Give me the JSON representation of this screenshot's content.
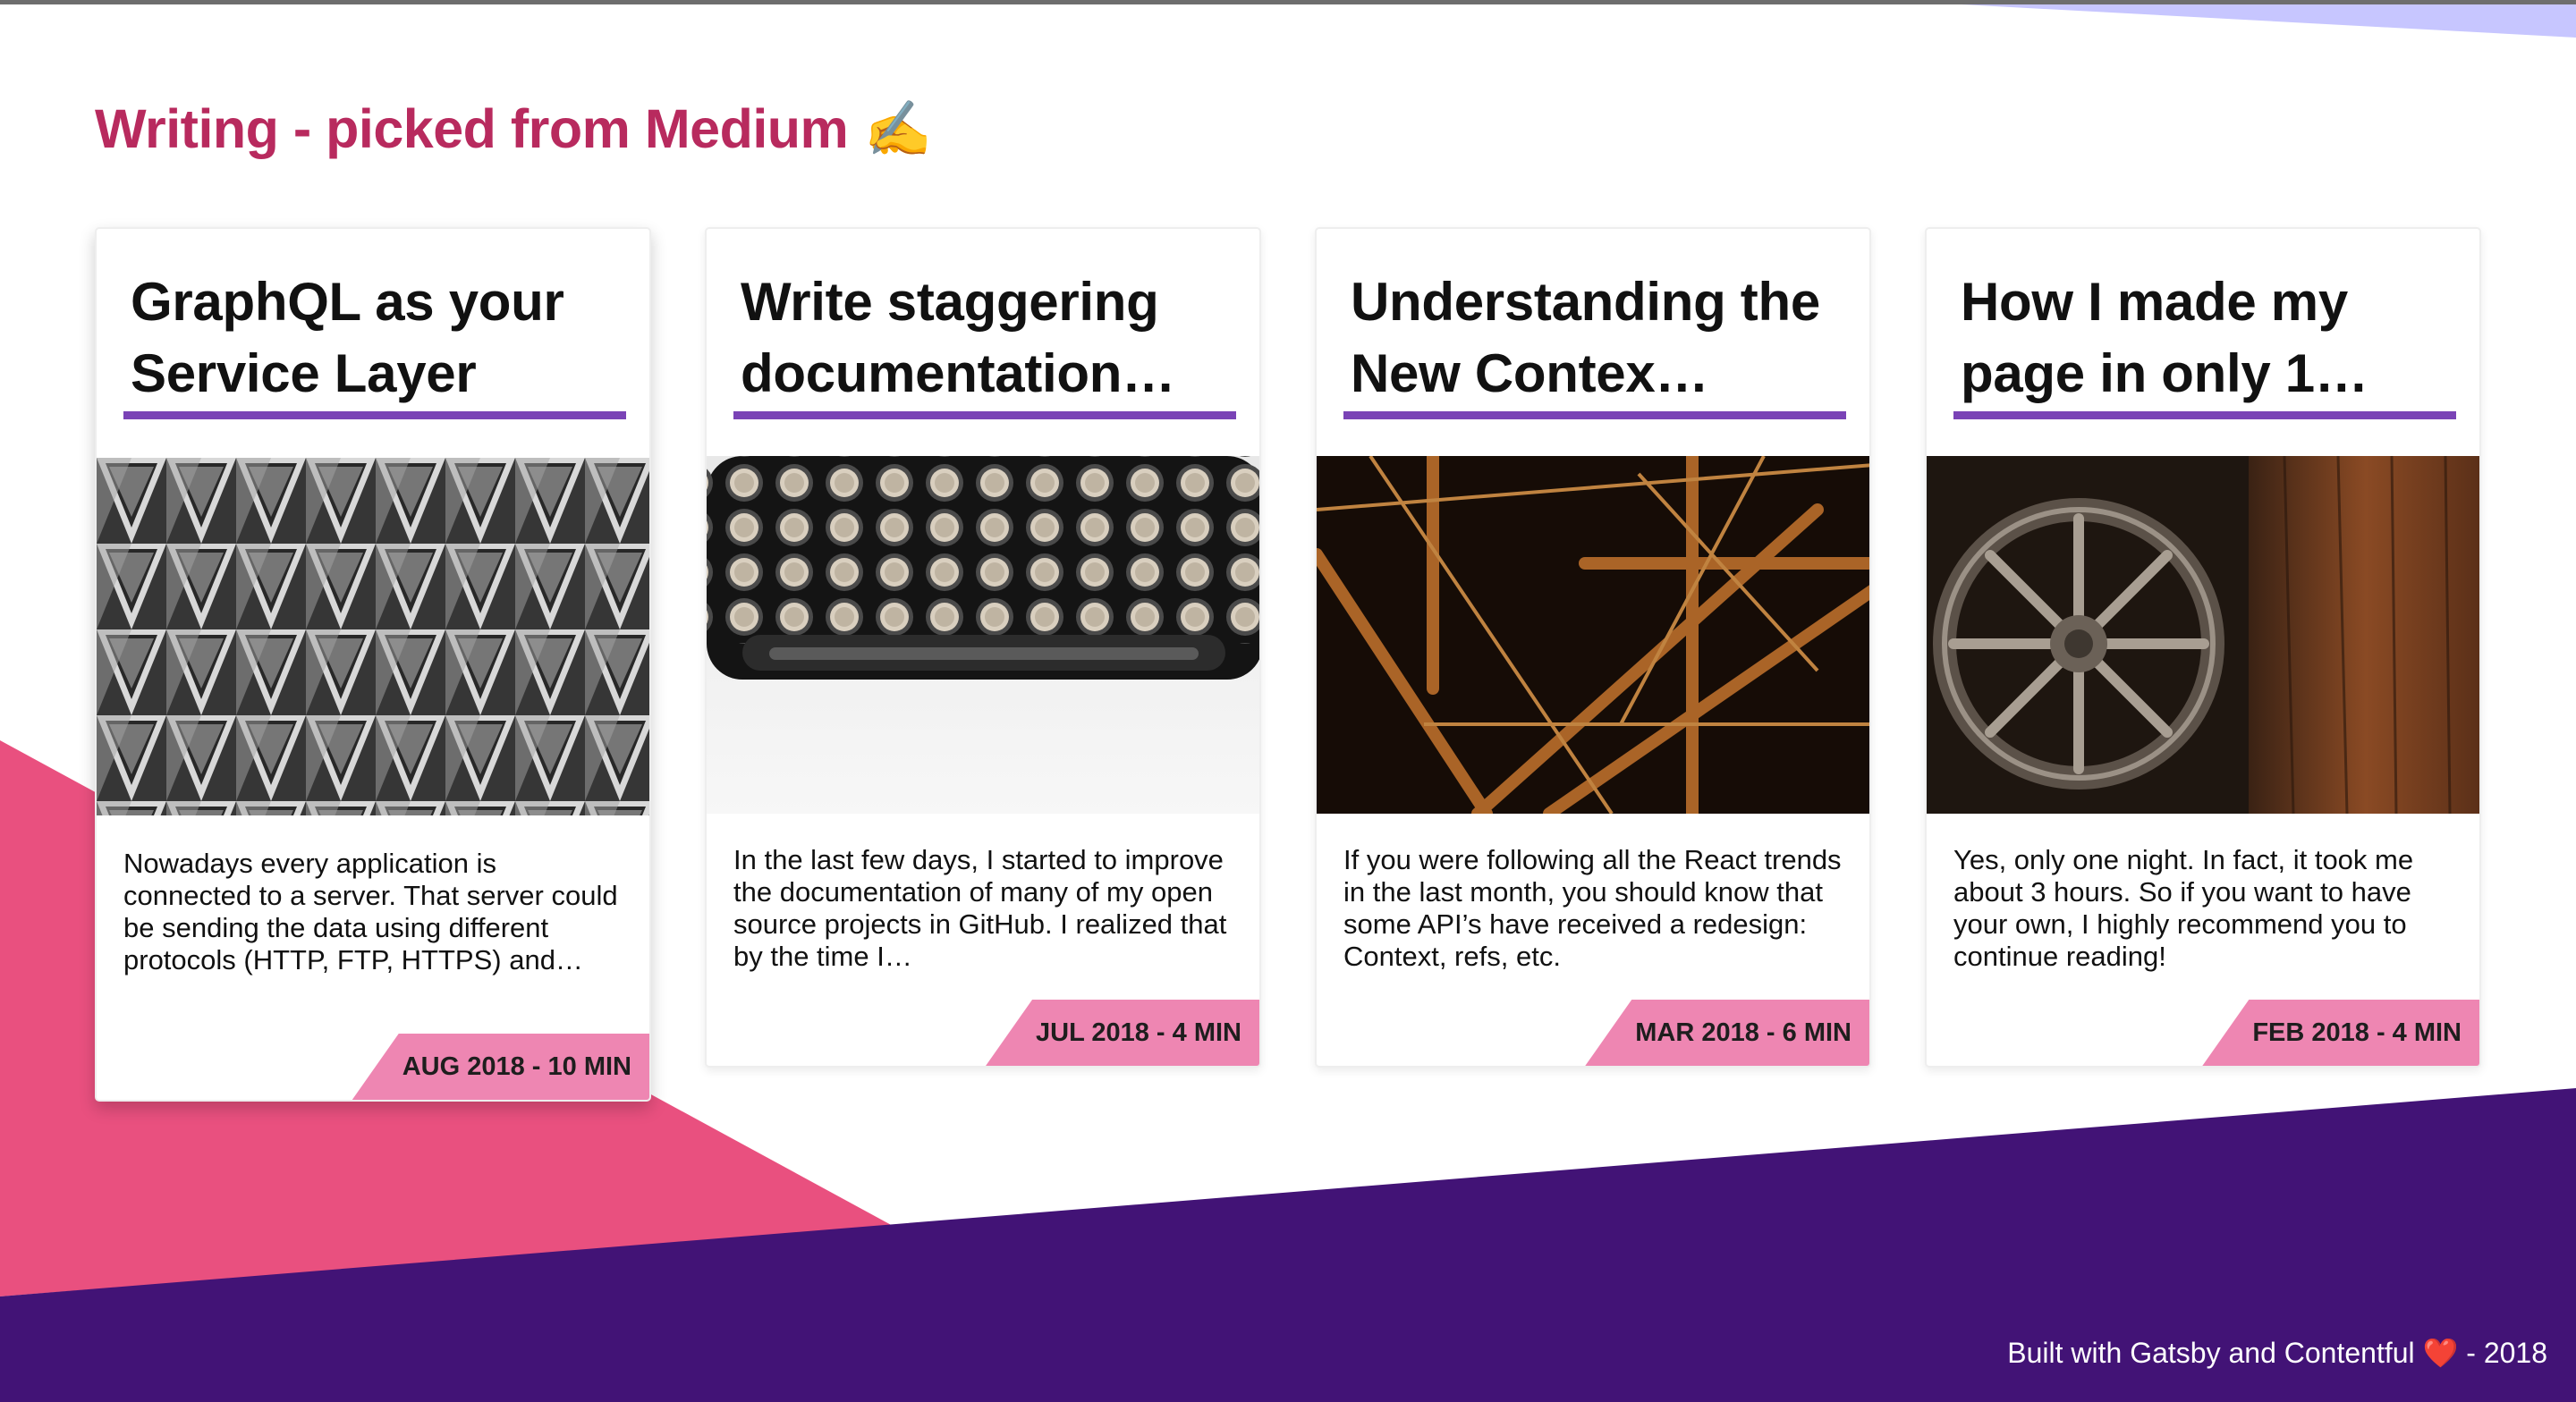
{
  "colors": {
    "accent_purple": "#7a43b6",
    "title_pink": "#b82a5e",
    "badge_pink": "#ee86b2",
    "shape_pink": "#e9507f",
    "shape_purple": "#421376"
  },
  "section": {
    "title": "Writing - picked from Medium",
    "title_icon": "✍️",
    "icon_name": "writing-hand-icon"
  },
  "posts": [
    {
      "title": "GraphQL as your Service Layer",
      "excerpt": "Nowadays every application is connected to a server. That server could be sending the data using different protocols (HTTP, FTP, HTTPS) and…",
      "badge": "AUG 2018 - 10 MIN",
      "image": "concrete-lattice-building-photo"
    },
    {
      "title": "Write staggering documentation…",
      "excerpt": "In the last few days, I started to improve the documentation of many of my open source projects in GitHub. I realized that by the time I…",
      "badge": "JUL 2018 - 4 MIN",
      "image": "typewriter-keys-photo"
    },
    {
      "title": "Understanding the New Contex…",
      "excerpt": "If you were following all the React trends in the last month, you should know that some API’s have received a redesign: Context, refs, etc.",
      "badge": "MAR 2018 - 6 MIN",
      "image": "steel-bridge-at-night-photo"
    },
    {
      "title": "How I made my page in only 1…",
      "excerpt": "Yes, only one night. In fact, it took me about 3 hours. So if you want to have your own, I highly recommend you to continue reading!",
      "badge": "FEB 2018 - 4 MIN",
      "image": "wooden-wagon-wheel-photo"
    }
  ],
  "footer": {
    "text_before": "Built with Gatsby and Contentful",
    "heart": "❤️",
    "text_after": "- 2018"
  }
}
